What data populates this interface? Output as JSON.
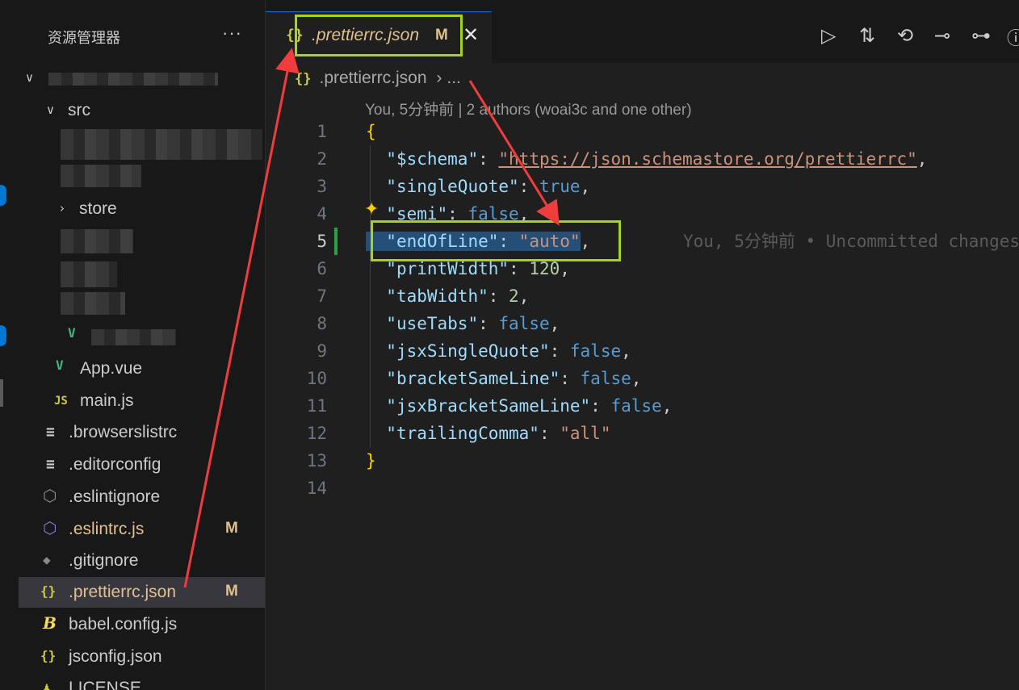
{
  "sidebar": {
    "title": "资源管理器",
    "more": "···",
    "items": [
      {
        "label": "src",
        "chevron": "∨"
      },
      {
        "label": "store",
        "chevron": "›"
      },
      {
        "label": "App.vue",
        "icon": "V"
      },
      {
        "label": "main.js",
        "icon": "JS"
      },
      {
        "label": ".browserslistrc",
        "icon": "≡"
      },
      {
        "label": ".editorconfig",
        "icon": "≡"
      },
      {
        "label": ".eslintignore",
        "icon": "⬡"
      },
      {
        "label": ".eslintrc.js",
        "icon": "⬡",
        "badge": "M"
      },
      {
        "label": ".gitignore",
        "icon": "◆"
      },
      {
        "label": ".prettierrc.json",
        "icon": "{}",
        "badge": "M"
      },
      {
        "label": "babel.config.js",
        "icon": "B"
      },
      {
        "label": "jsconfig.json",
        "icon": "{}"
      },
      {
        "label": "LICENSE",
        "icon": "♟"
      }
    ]
  },
  "tab": {
    "icon": "{}",
    "name": ".prettierrc.json",
    "modified": "M",
    "close": "✕"
  },
  "actions": [
    "▷",
    "⇅",
    "⟲",
    "⊸",
    "⊶"
  ],
  "breadcrumb": {
    "icon": "{}",
    "file": ".prettierrc.json",
    "sep": "›",
    "rest": "..."
  },
  "codelens": "You, 5分钟前 | 2 authors (woai3c and one other)",
  "blame": "You, 5分钟前 • Uncommitted changes",
  "line_numbers": [
    "1",
    "2",
    "3",
    "4",
    "5",
    "6",
    "7",
    "8",
    "9",
    "10",
    "11",
    "12",
    "13",
    "14"
  ],
  "code": {
    "open": "{",
    "close": "}",
    "schema_key": "\"$schema\"",
    "schema_val": "\"https://json.schemastore.org/prettierrc\"",
    "singleQuote_key": "\"singleQuote\"",
    "singleQuote_val": "true",
    "semi_key": "\"semi\"",
    "semi_val": "false",
    "endOfLine_key": "\"endOfLine\"",
    "endOfLine_val": "\"auto\"",
    "printWidth_key": "\"printWidth\"",
    "printWidth_val": "120",
    "tabWidth_key": "\"tabWidth\"",
    "tabWidth_val": "2",
    "useTabs_key": "\"useTabs\"",
    "useTabs_val": "false",
    "jsxSingleQuote_key": "\"jsxSingleQuote\"",
    "jsxSingleQuote_val": "false",
    "bracketSameLine_key": "\"bracketSameLine\"",
    "bracketSameLine_val": "false",
    "jsxBracketSameLine_key": "\"jsxBracketSameLine\"",
    "jsxBracketSameLine_val": "false",
    "trailingComma_key": "\"trailingComma\"",
    "trailingComma_val": "\"all\""
  },
  "colors": {
    "accent": "#0078d4",
    "modified": "#e2c08d",
    "annotation": "#a4d41e",
    "arrow": "#f03c3c"
  }
}
